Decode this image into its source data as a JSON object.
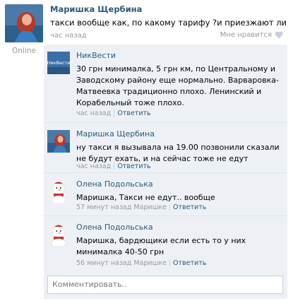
{
  "post": {
    "author": "Маришка Щербина",
    "text": "такси вообще как, по какому тарифу ?и приезжают ли",
    "time": "час назад",
    "like_label": "Мне нравится",
    "online": "Online"
  },
  "replies": [
    {
      "author": "НикВести",
      "text": "30 грн минималка, 5 грн км, по Центральному и Заводскому району еще нормально. Варваровка-Матвеевка традиционно плохо. Ленинский и Корабельный тоже плохо.",
      "time": "час назад",
      "reply_label": "Ответить",
      "avatar_logo": "НикВести"
    },
    {
      "author": "Маришка Щербина",
      "text": "ну такси я вызывала на 19.00 позвонили сказали не будут ехать, и на сейчас тоже не едут",
      "time": "час назад",
      "reply_label": "Ответить"
    },
    {
      "author": "Олена Подольська",
      "text": "Маришка, Такси не едут.. вообще",
      "time": "57 минут назад",
      "to": "Маришке",
      "reply_label": "Ответить"
    },
    {
      "author": "Олена Подольська",
      "text": "Маришка, бардющики если есть то у них минималка 40-50 грн",
      "time": "56 минут назад",
      "to": "Маришке",
      "reply_label": "Ответить"
    }
  ],
  "comment_input": {
    "placeholder": "Комментировать.."
  },
  "colors": {
    "link": "#2b587a",
    "meta": "#999999",
    "replies_bg": "#edf1f5"
  }
}
